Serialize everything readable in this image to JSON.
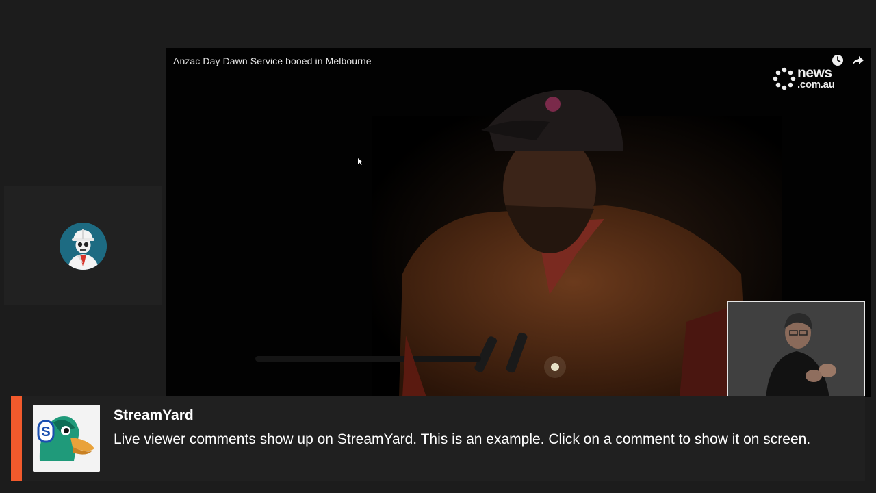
{
  "video": {
    "title": "Anzac Day Dawn Service booed in Melbourne",
    "brand_line1": "news",
    "brand_line2": ".com.au",
    "icons": [
      "clock-icon",
      "share-icon"
    ]
  },
  "participant": {
    "avatar_icon": "skeleton-hardhat-avatar"
  },
  "comment": {
    "name": "StreamYard",
    "text": "Live viewer comments show up on StreamYard. This is an example. Click on a comment to show it on screen.",
    "accent_color": "#f25a2c",
    "avatar_icon": "streamyard-duck-logo"
  },
  "colors": {
    "background": "#1c1c1c",
    "tile": "#212121",
    "banner": "#202020"
  }
}
